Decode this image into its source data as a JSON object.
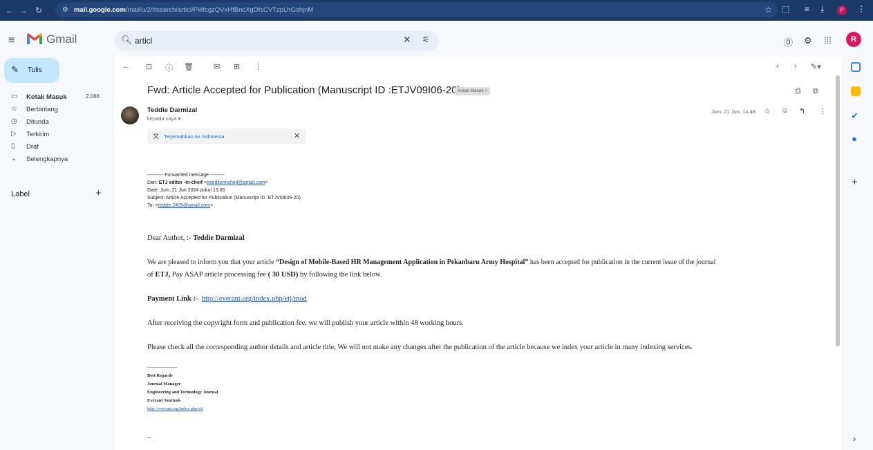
{
  "browser": {
    "url_host": "mail.google.com",
    "url_path": "/mail/u/2/#search/articl/FMfcgzQVxHfBncXgDfsCVTzpLhGshjnM",
    "profile_letter": "P"
  },
  "header": {
    "app_name": "Gmail",
    "search_value": "articl",
    "avatar_letter": "R"
  },
  "sidebar": {
    "compose_label": "Tulis",
    "items": [
      {
        "label": "Kotak Masuk",
        "count": "2.066",
        "icon": "inbox-icon"
      },
      {
        "label": "Berbintang",
        "icon": "star-icon"
      },
      {
        "label": "Ditunda",
        "icon": "clock-icon"
      },
      {
        "label": "Terkirim",
        "icon": "send-icon"
      },
      {
        "label": "Draf",
        "icon": "draft-icon"
      },
      {
        "label": "Selengkapnya",
        "icon": "chevron-down-icon"
      }
    ],
    "labels_heading": "Label"
  },
  "email": {
    "subject": "Fwd: Article Accepted for Publication (Manuscript ID :ETJV09I06-20)",
    "label_chip": "Kotak Masuk ×",
    "sender_name": "Teddie Darmizal",
    "recipient": "kepada saya ▾",
    "date": "Jum, 21 Jun, 14.48",
    "translate_link": "Terjemahkan ke Indonesia",
    "forwarded": {
      "header_line": "---------- Forwarded message ---------",
      "from_label": "Dari: ",
      "from_name": "ETJ editor -in-cheif",
      "from_email": "etjeditorincheif@gmail.com",
      "date_line": "Date: Jum, 21 Jun 2024 pukul 13.05",
      "subject_line": "Subject: Article Accepted for Publication (Manuscript ID :ETJV09I06-20)",
      "to_label": "To: <",
      "to_email": "teddie.2405@gmail.com",
      "to_close": ">"
    },
    "body": {
      "greeting_prefix": "Dear Author, :- ",
      "greeting_name": "Teddie Darmizal",
      "para1_a": "We are pleased to inform you that your article ",
      "para1_title": "“Design of Mobile-Based HR Management Application in Pekanbaru Army Hospital”",
      "para1_b": " has been accepted for publication in the current issue of the journal",
      "para1_c": "of ",
      "para1_journal": "ETJ,",
      "para1_d": " Pay ASAP article processing fee ",
      "para1_fee": "( 30 USD)",
      "para1_e": " by following the link below.",
      "payment_label": "Payment Link :-",
      "payment_link": "http://everant.org/index.php/etj/mod",
      "para2": "After receiving the copyright form and publication fee, we will publish your article within 48 working hours.",
      "para3": "Please check all the corresponding author details and article title, We will not make any changes after the publication of the article because we index your article in many indexing services."
    },
    "signature": {
      "divider": "--------------------",
      "line1": "Best Regards",
      "line2": "Journal Manager",
      "line3": "Engineering and Technology Journal",
      "line4": "Everant Journals",
      "link": "http://everant.org/index.php/etj",
      "trailer": "--"
    }
  }
}
